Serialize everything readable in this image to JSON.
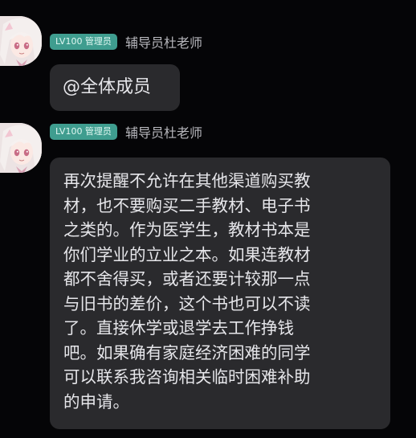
{
  "messages": [
    {
      "badge": "LV100 管理员",
      "sender": "辅导员杜老师",
      "lines": [
        "@全体成员"
      ]
    },
    {
      "badge": "LV100 管理员",
      "sender": "辅导员杜老师",
      "lines": [
        "再次提醒不允许在其他渠道购买教",
        "材，也不要购买二手教材、电子书",
        "之类的。作为医学生，教材书本是",
        "你们学业的立业之本。如果连教材",
        "都不舍得买，或者还要计较那一点",
        "与旧书的差价，这个书也可以不读",
        "了。直接休学或退学去工作挣钱",
        "吧。如果确有家庭经济困难的同学",
        "可以联系我咨询相关临时困难补助",
        "的申请。"
      ]
    }
  ],
  "colors": {
    "background": "#050507",
    "bubble": "#2a2a2d",
    "badge": "#3f9d8f",
    "sender_text": "#b7b7bc",
    "message_text": "#e6e6ea"
  },
  "icons": [
    "anime-girl-avatar"
  ]
}
